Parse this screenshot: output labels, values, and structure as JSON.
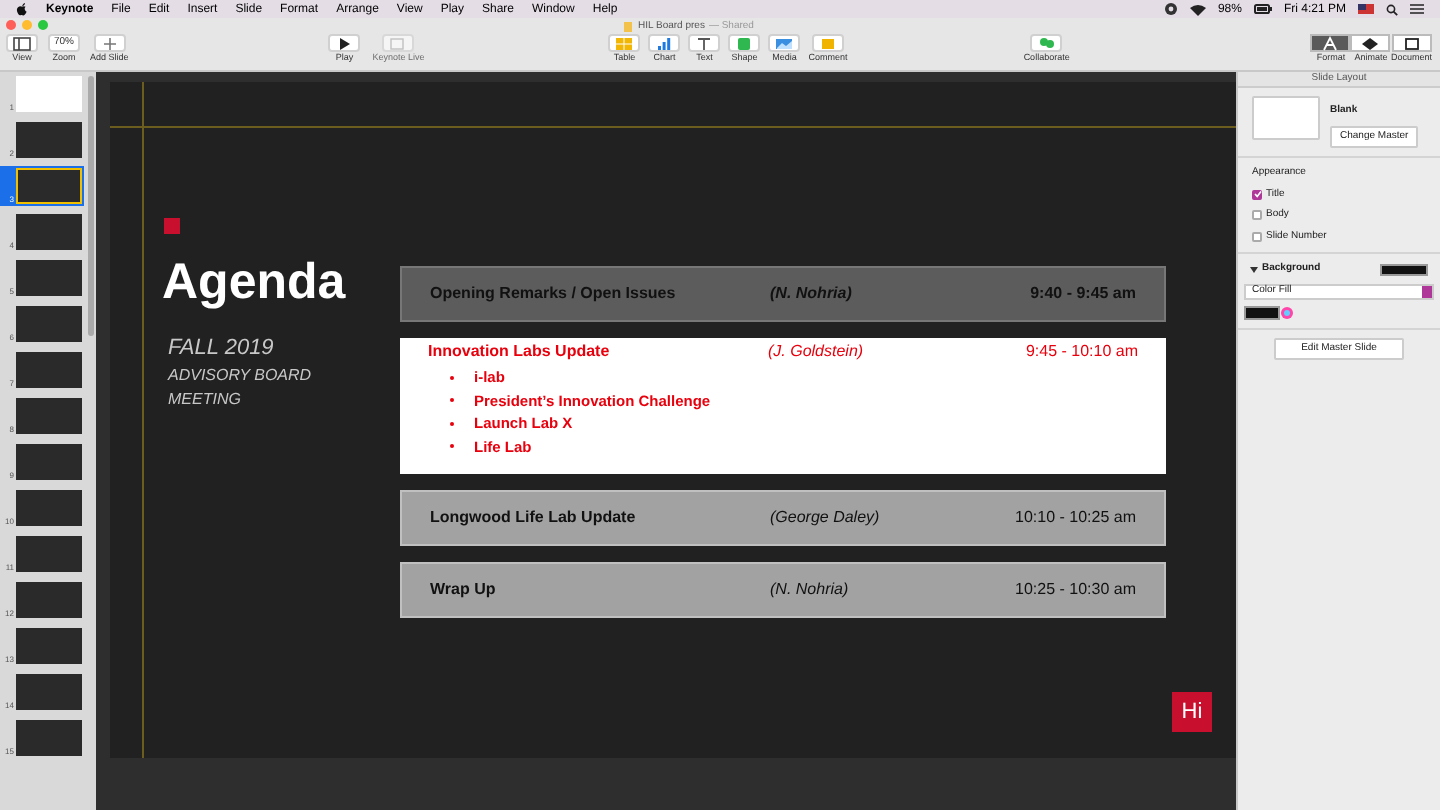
{
  "menubar": {
    "app": "Keynote",
    "items": [
      "File",
      "Edit",
      "Insert",
      "Slide",
      "Format",
      "Arrange",
      "View",
      "Play",
      "Share",
      "Window",
      "Help"
    ],
    "battery": "98%",
    "clock": "Fri 4:21 PM"
  },
  "window": {
    "title": "HIL Board pres",
    "subtitle": "— Shared"
  },
  "toolbar": {
    "left": [
      {
        "label": "View",
        "kind": "view"
      },
      {
        "label": "Zoom",
        "kind": "zoom",
        "value": "70%"
      },
      {
        "label": "Add Slide",
        "kind": "add"
      }
    ],
    "play": [
      {
        "label": "Play",
        "kind": "play",
        "disabled": false
      },
      {
        "label": "Keynote Live",
        "kind": "live",
        "disabled": true
      }
    ],
    "insert": [
      {
        "label": "Table",
        "kind": "table"
      },
      {
        "label": "Chart",
        "kind": "chart"
      },
      {
        "label": "Text",
        "kind": "text"
      },
      {
        "label": "Shape",
        "kind": "shape"
      },
      {
        "label": "Media",
        "kind": "media"
      },
      {
        "label": "Comment",
        "kind": "comment"
      }
    ],
    "collaborate": "Collaborate",
    "inspector_tabs": [
      {
        "label": "Format",
        "kind": "format",
        "selected": true
      },
      {
        "label": "Animate",
        "kind": "animate",
        "selected": false
      },
      {
        "label": "Document",
        "kind": "document",
        "selected": false
      }
    ]
  },
  "navigator": {
    "slides": [
      {
        "number": "1",
        "selected": false
      },
      {
        "number": "2",
        "selected": false
      },
      {
        "number": "3",
        "selected": true
      },
      {
        "number": "4",
        "selected": false
      },
      {
        "number": "5",
        "selected": false
      },
      {
        "number": "6",
        "selected": false
      },
      {
        "number": "7",
        "selected": false
      },
      {
        "number": "8",
        "selected": false
      },
      {
        "number": "9",
        "selected": false
      },
      {
        "number": "10",
        "selected": false
      },
      {
        "number": "11",
        "selected": false
      },
      {
        "number": "12",
        "selected": false
      },
      {
        "number": "13",
        "selected": false
      },
      {
        "number": "14",
        "selected": false
      },
      {
        "number": "15",
        "selected": false
      }
    ]
  },
  "slide": {
    "title": "Agenda",
    "subtitle": [
      "FALL 2019",
      "ADVISORY BOARD",
      "MEETING"
    ],
    "rows": [
      {
        "kind": "dark",
        "topic": "Opening Remarks / Open Issues",
        "presenter": "(N. Nohria)",
        "time": "9:40 - 9:45 am",
        "bullets": []
      },
      {
        "kind": "white",
        "topic": "Innovation Labs Update",
        "presenter": "(J. Goldstein)",
        "time": "9:45 - 10:10 am",
        "bullets": [
          "i-lab",
          "President’s Innovation Challenge",
          "Launch Lab X",
          "Life Lab"
        ]
      },
      {
        "kind": "light",
        "topic": "Longwood Life Lab Update",
        "presenter": "(George Daley)",
        "time": "10:10 - 10:25 am",
        "bullets": []
      },
      {
        "kind": "light",
        "topic": "Wrap Up",
        "presenter": "(N. Nohria)",
        "time": "10:25 - 10:30 am",
        "bullets": []
      }
    ],
    "logo": "Hi"
  },
  "inspector": {
    "header": "Slide Layout",
    "master": "Blank",
    "change_master": "Change Master",
    "appearance": "Appearance",
    "options": [
      {
        "label": "Title",
        "checked": true
      },
      {
        "label": "Body",
        "checked": false
      },
      {
        "label": "Slide Number",
        "checked": false
      }
    ],
    "background": {
      "label": "Background",
      "expanded": true,
      "fill": "Color Fill"
    },
    "edit_master": "Edit Master Slide"
  }
}
